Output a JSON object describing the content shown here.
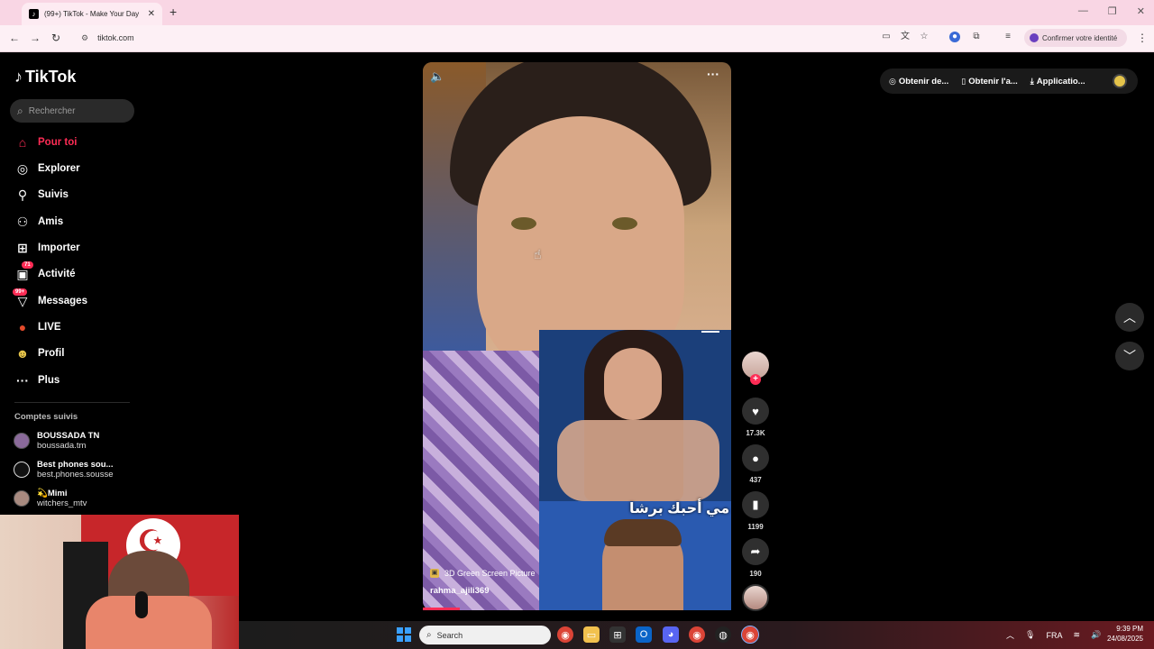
{
  "browser": {
    "tab_title": "(99+) TikTok - Make Your Day",
    "tab_favicon": "tiktok-icon",
    "new_tab": "+",
    "url": "tiktok.com",
    "verify_label": "Confirmer votre identité"
  },
  "sidebar": {
    "logo_text": "TikTok",
    "search_placeholder": "Rechercher",
    "nav": [
      {
        "label": "Pour toi",
        "icon": "home-icon",
        "active": true
      },
      {
        "label": "Explorer",
        "icon": "compass-icon"
      },
      {
        "label": "Suivis",
        "icon": "following-icon"
      },
      {
        "label": "Amis",
        "icon": "friends-icon"
      },
      {
        "label": "Importer",
        "icon": "upload-icon"
      },
      {
        "label": "Activité",
        "icon": "activity-icon",
        "badge": "71"
      },
      {
        "label": "Messages",
        "icon": "messages-icon",
        "badge": "99+"
      },
      {
        "label": "LIVE",
        "icon": "live-icon"
      },
      {
        "label": "Profil",
        "icon": "profile-icon"
      },
      {
        "label": "Plus",
        "icon": "more-icon"
      }
    ],
    "followed_title": "Comptes suivis",
    "accounts": [
      {
        "name": "BOUSSADA TN",
        "handle": "boussada.tm"
      },
      {
        "name": "Best phones sou...",
        "handle": "best.phones.sousse"
      },
      {
        "name": "💫Mimi",
        "handle": "witchers_mtv"
      }
    ]
  },
  "video": {
    "overlay_text": "مي أحبك  برشا",
    "effect_label": "3D Green Screen Picture",
    "author": "rahma_ajili369",
    "progress_fraction": 0.12
  },
  "actions": {
    "likes": "17.3K",
    "comments": "437",
    "saves": "1199",
    "shares": "190"
  },
  "top_pills": [
    {
      "label": "Obtenir de...",
      "icon": "coin-icon"
    },
    {
      "label": "Obtenir l'a...",
      "icon": "phone-icon"
    },
    {
      "label": "Applicatio...",
      "icon": "download-icon"
    }
  ],
  "taskbar": {
    "search_placeholder": "Search",
    "lang": "FRA",
    "time": "9:39 PM",
    "date": "24/08/2025"
  },
  "colors": {
    "accent": "#fe2c55",
    "tab_bar": "#f9d6e4"
  }
}
